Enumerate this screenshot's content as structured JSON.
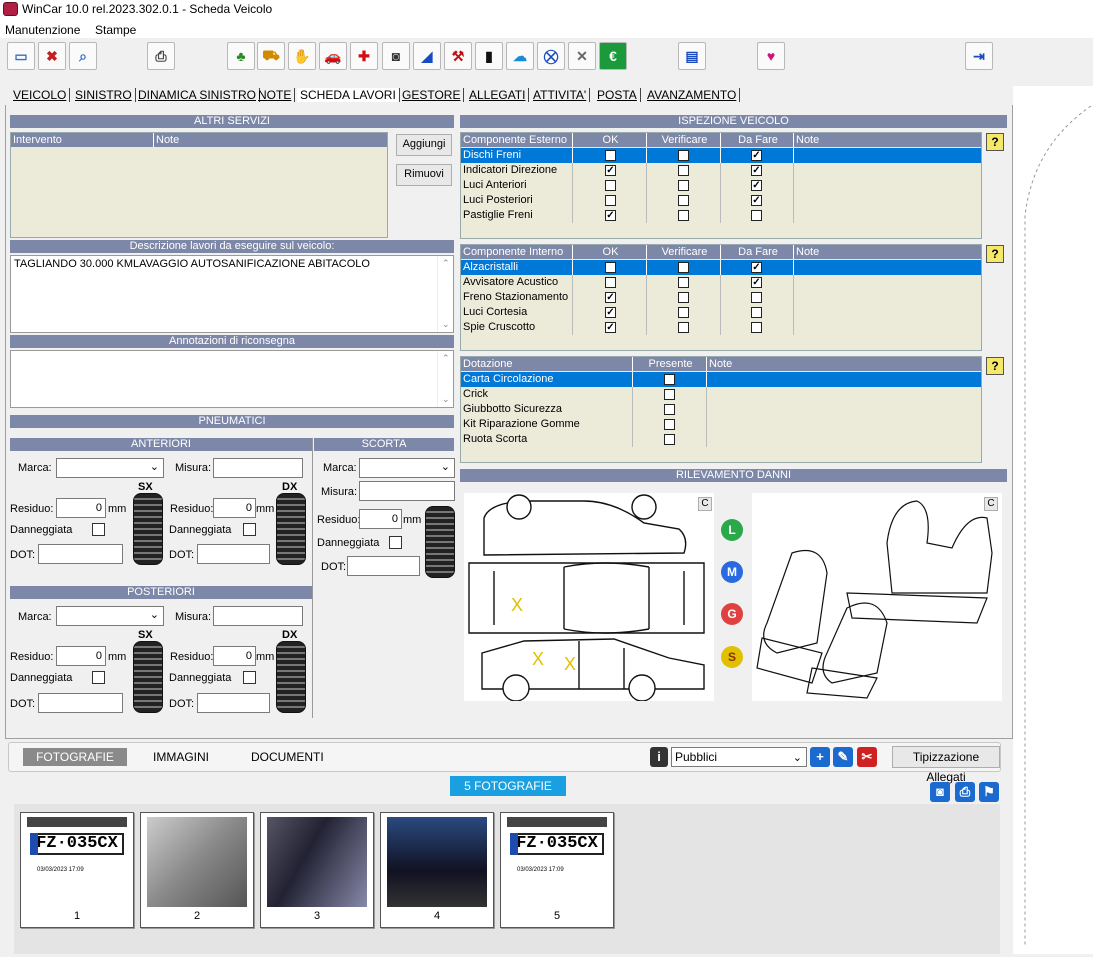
{
  "window": {
    "title": "WinCar 10.0 rel.2023.302.0.1 - Scheda Veicolo"
  },
  "menu": [
    "Manutenzione",
    "Stampe"
  ],
  "tabs": [
    "VEICOLO",
    "SINISTRO",
    "DINAMICA SINISTRO",
    "NOTE",
    "SCHEDA LAVORI",
    "GESTORE",
    "ALLEGATI",
    "ATTIVITA'",
    "POSTA",
    "AVANZAMENTO"
  ],
  "altri_servizi": {
    "title": "ALTRI SERVIZI",
    "col_intervento": "Intervento",
    "col_note": "Note",
    "add": "Aggiungi",
    "remove": "Rimuovi"
  },
  "descrizione": {
    "title": "Descrizione lavori da eseguire sul veicolo:",
    "text": "TAGLIANDO 30.000 KMLAVAGGIO AUTOSANIFICAZIONE ABITACOLO"
  },
  "annotazioni": {
    "title": "Annotazioni di riconsegna",
    "text": ""
  },
  "ispezione": {
    "title": "ISPEZIONE VEICOLO",
    "esterno": {
      "cols": [
        "Componente Esterno",
        "OK",
        "Verificare",
        "Da Fare",
        "Note"
      ],
      "rows": [
        {
          "name": "Dischi Freni",
          "ok": "",
          "ver": "",
          "fare": "✓"
        },
        {
          "name": "Indicatori Direzione",
          "ok": "✓",
          "ver": "",
          "fare": "✓"
        },
        {
          "name": "Luci Anteriori",
          "ok": "",
          "ver": "",
          "fare": "✓"
        },
        {
          "name": "Luci Posteriori",
          "ok": "",
          "ver": "",
          "fare": "✓"
        },
        {
          "name": "Pastiglie Freni",
          "ok": "✓",
          "ver": "",
          "fare": ""
        }
      ]
    },
    "interno": {
      "cols": [
        "Componente Interno",
        "OK",
        "Verificare",
        "Da Fare",
        "Note"
      ],
      "rows": [
        {
          "name": "Alzacristalli",
          "ok": "",
          "ver": "",
          "fare": "✓"
        },
        {
          "name": "Avvisatore Acustico",
          "ok": "",
          "ver": "",
          "fare": "✓"
        },
        {
          "name": "Freno Stazionamento",
          "ok": "✓",
          "ver": "",
          "fare": ""
        },
        {
          "name": "Luci Cortesia",
          "ok": "✓",
          "ver": "",
          "fare": ""
        },
        {
          "name": "Spie Cruscotto",
          "ok": "✓",
          "ver": "",
          "fare": ""
        }
      ]
    },
    "dotazione": {
      "cols": [
        "Dotazione",
        "Presente",
        "Note"
      ],
      "rows": [
        {
          "name": "Carta Circolazione",
          "pres": ""
        },
        {
          "name": "Crick",
          "pres": ""
        },
        {
          "name": "Giubbotto Sicurezza",
          "pres": ""
        },
        {
          "name": "Kit Riparazione Gomme",
          "pres": ""
        },
        {
          "name": "Ruota Scorta",
          "pres": ""
        }
      ]
    },
    "help": "?"
  },
  "pneumatici": {
    "title": "PNEUMATICI",
    "anteriori": "ANTERIORI",
    "posteriori": "POSTERIORI",
    "scorta": "SCORTA",
    "marca": "Marca:",
    "misura": "Misura:",
    "residuo": "Residuo:",
    "danneggiata": "Danneggiata",
    "dot": "DOT:",
    "mm": "mm",
    "sx": "SX",
    "dx": "DX",
    "residuo_ant_sx": "0",
    "residuo_ant_dx": "0",
    "residuo_post_sx": "0",
    "residuo_post_dx": "0",
    "residuo_scorta": "0"
  },
  "rilevamento": {
    "title": "RILEVAMENTO DANNI",
    "c": "C",
    "marker": "X",
    "legend": [
      "L",
      "M",
      "G",
      "S"
    ]
  },
  "bottom": {
    "tabs": [
      "FOTOGRAFIE",
      "IMMAGINI",
      "DOCUMENTI"
    ],
    "filter": "Pubblici",
    "tip": "Tipizzazione Allegati",
    "count": "5 FOTOGRAFIE",
    "photos": [
      {
        "num": "1",
        "plate": "FZ·035CX",
        "date": "03/03/2023 17:09"
      },
      {
        "num": "2"
      },
      {
        "num": "3"
      },
      {
        "num": "4"
      },
      {
        "num": "5",
        "plate": "FZ·035CX",
        "date": "03/03/2023 17:09"
      }
    ]
  },
  "colors": {
    "header": "#7d87a7",
    "selection": "#0078d7",
    "grid_bg": "#ecead9",
    "count_badge": "#1aa0e0"
  }
}
